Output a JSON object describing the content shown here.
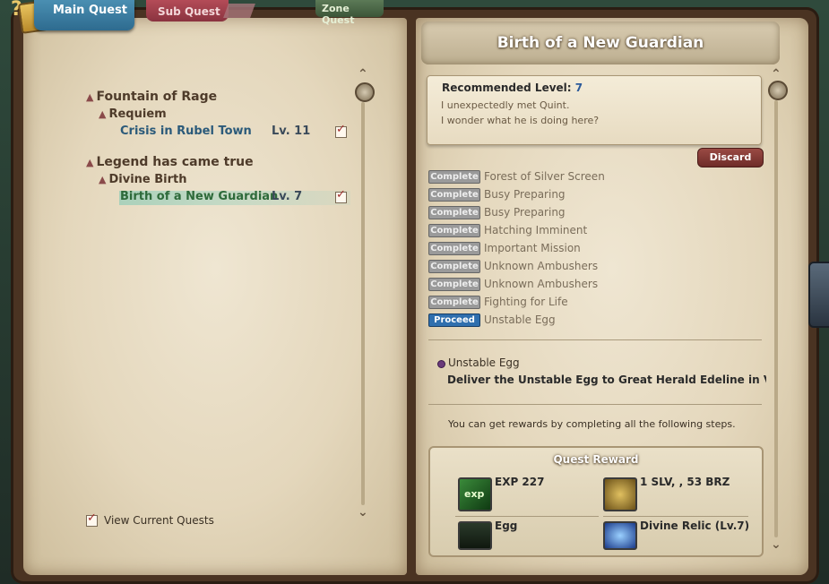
{
  "tabs": {
    "main": "Main Quest",
    "sub": "Sub Quest",
    "zone": "Zone Quest"
  },
  "left": {
    "categories": [
      {
        "label": "Fountain of Rage",
        "sub": "Requiem",
        "quest": "Crisis in Rubel Town",
        "level": "Lv. 11"
      },
      {
        "label": "Legend has came true",
        "sub": "Divine Birth",
        "quest": "Birth of a New Guardian",
        "level": "Lv. 7"
      }
    ],
    "view_current": "View Current Quests"
  },
  "right": {
    "title": "Birth of a New Guardian",
    "recommended_label": "Recommended Level:",
    "recommended_value": "7",
    "desc1": "I unexpectedly met Quint.",
    "desc2": "I wonder what he is doing here?",
    "discard": "Discard",
    "steps": [
      {
        "status": "Complete",
        "name": "Forest of Silver Screen"
      },
      {
        "status": "Complete",
        "name": "Busy Preparing"
      },
      {
        "status": "Complete",
        "name": "Busy Preparing"
      },
      {
        "status": "Complete",
        "name": "Hatching Imminent"
      },
      {
        "status": "Complete",
        "name": "Important Mission"
      },
      {
        "status": "Complete",
        "name": "Unknown Ambushers"
      },
      {
        "status": "Complete",
        "name": "Unknown Ambushers"
      },
      {
        "status": "Complete",
        "name": "Fighting for Life"
      },
      {
        "status": "Proceed",
        "name": "Unstable Egg"
      }
    ],
    "objective_title": "Unstable Egg",
    "objective_desc": "Deliver the Unstable Egg to Great Herald Edeline in Vulc",
    "rewards_note": "You can get rewards by completing all the following steps.",
    "reward_header": "Quest Reward",
    "rewards": {
      "exp": "EXP 227",
      "money": "1  SLV, , 53  BRZ",
      "item1": "Egg",
      "item2": "Divine Relic (Lv.7)"
    },
    "icon_names": [
      "exp-icon",
      "coins-icon",
      "egg-icon",
      "relic-orb-icon"
    ]
  }
}
